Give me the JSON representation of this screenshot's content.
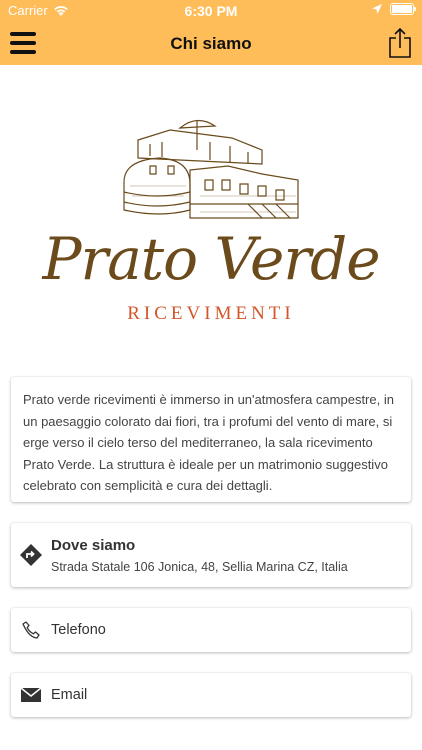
{
  "status": {
    "carrier": "Carrier",
    "time": "6:30 PM"
  },
  "nav": {
    "title": "Chi siamo",
    "menu_icon": "menu-icon",
    "share_icon": "share-icon"
  },
  "logo": {
    "name": "Prato Verde",
    "subtitle": "RICEVIMENTI"
  },
  "about": {
    "text": "Prato verde ricevimenti è immerso in un'atmosfera campestre, in un paesaggio colorato dai fiori, tra i profumi del vento di mare, si erge verso il cielo terso del mediterraneo, la sala ricevimento Prato Verde. La struttura è ideale per un matrimonio suggestivo celebrato con semplicità e cura dei dettagli."
  },
  "location": {
    "title": "Dove siamo",
    "address": "Strada Statale 106 Jonica, 48, Sellia Marina CZ, Italia"
  },
  "phone": {
    "label": "Telefono"
  },
  "email": {
    "label": "Email"
  },
  "colors": {
    "accent": "#ffbd59",
    "logo_brown": "#6b4a1c",
    "logo_orange": "#d2562a"
  }
}
